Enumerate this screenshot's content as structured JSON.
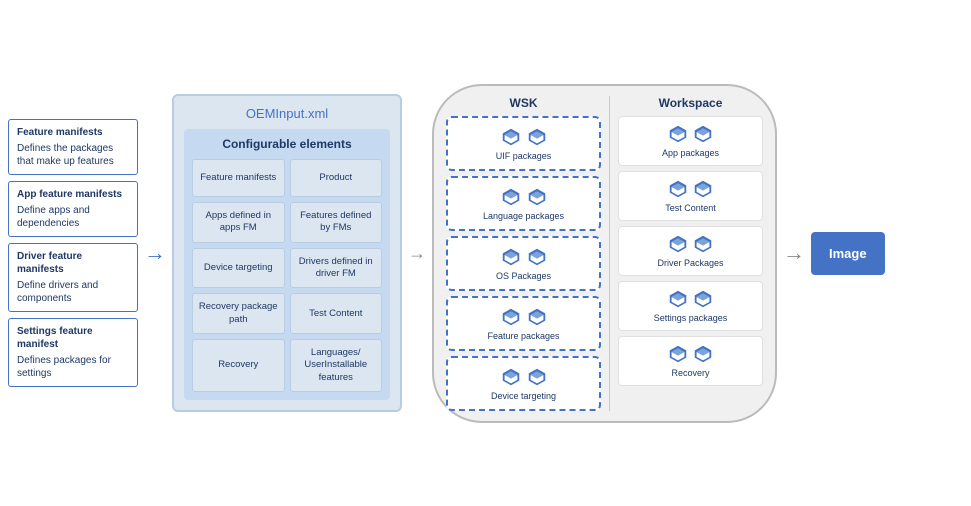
{
  "sidebar": {
    "items": [
      {
        "id": "feature-manifests",
        "title": "Feature manifests",
        "description": "Defines the packages that make up features"
      },
      {
        "id": "app-feature-manifests",
        "title": "App feature manifests",
        "description": "Define apps and dependencies"
      },
      {
        "id": "driver-feature-manifests",
        "title": "Driver feature manifests",
        "description": "Define drivers and components"
      },
      {
        "id": "settings-feature-manifest",
        "title": "Settings feature manifest",
        "description": "Defines packages for settings"
      }
    ]
  },
  "oem": {
    "title": "OEMInput.xml",
    "configurable": {
      "title": "Configurable elements",
      "cells": [
        "Feature manifests",
        "Product",
        "Apps defined in apps FM",
        "Features defined by FMs",
        "Device targeting",
        "Drivers defined in driver FM",
        "Recovery package path",
        "Test Content",
        "Recovery",
        "Languages/ UserInstallable features"
      ]
    }
  },
  "wsk": {
    "title": "WSK",
    "items": [
      {
        "label": "UIF packages"
      },
      {
        "label": "Language packages"
      },
      {
        "label": "OS Packages"
      },
      {
        "label": "Feature packages"
      },
      {
        "label": "Device targeting"
      }
    ]
  },
  "workspace": {
    "title": "Workspace",
    "items": [
      {
        "label": "App packages"
      },
      {
        "label": "Test Content"
      },
      {
        "label": "Driver Packages"
      },
      {
        "label": "Settings packages"
      },
      {
        "label": "Recovery"
      }
    ]
  },
  "image_button": {
    "label": "Image"
  },
  "arrows": {
    "right": "→",
    "mid": "→",
    "final": "→"
  }
}
